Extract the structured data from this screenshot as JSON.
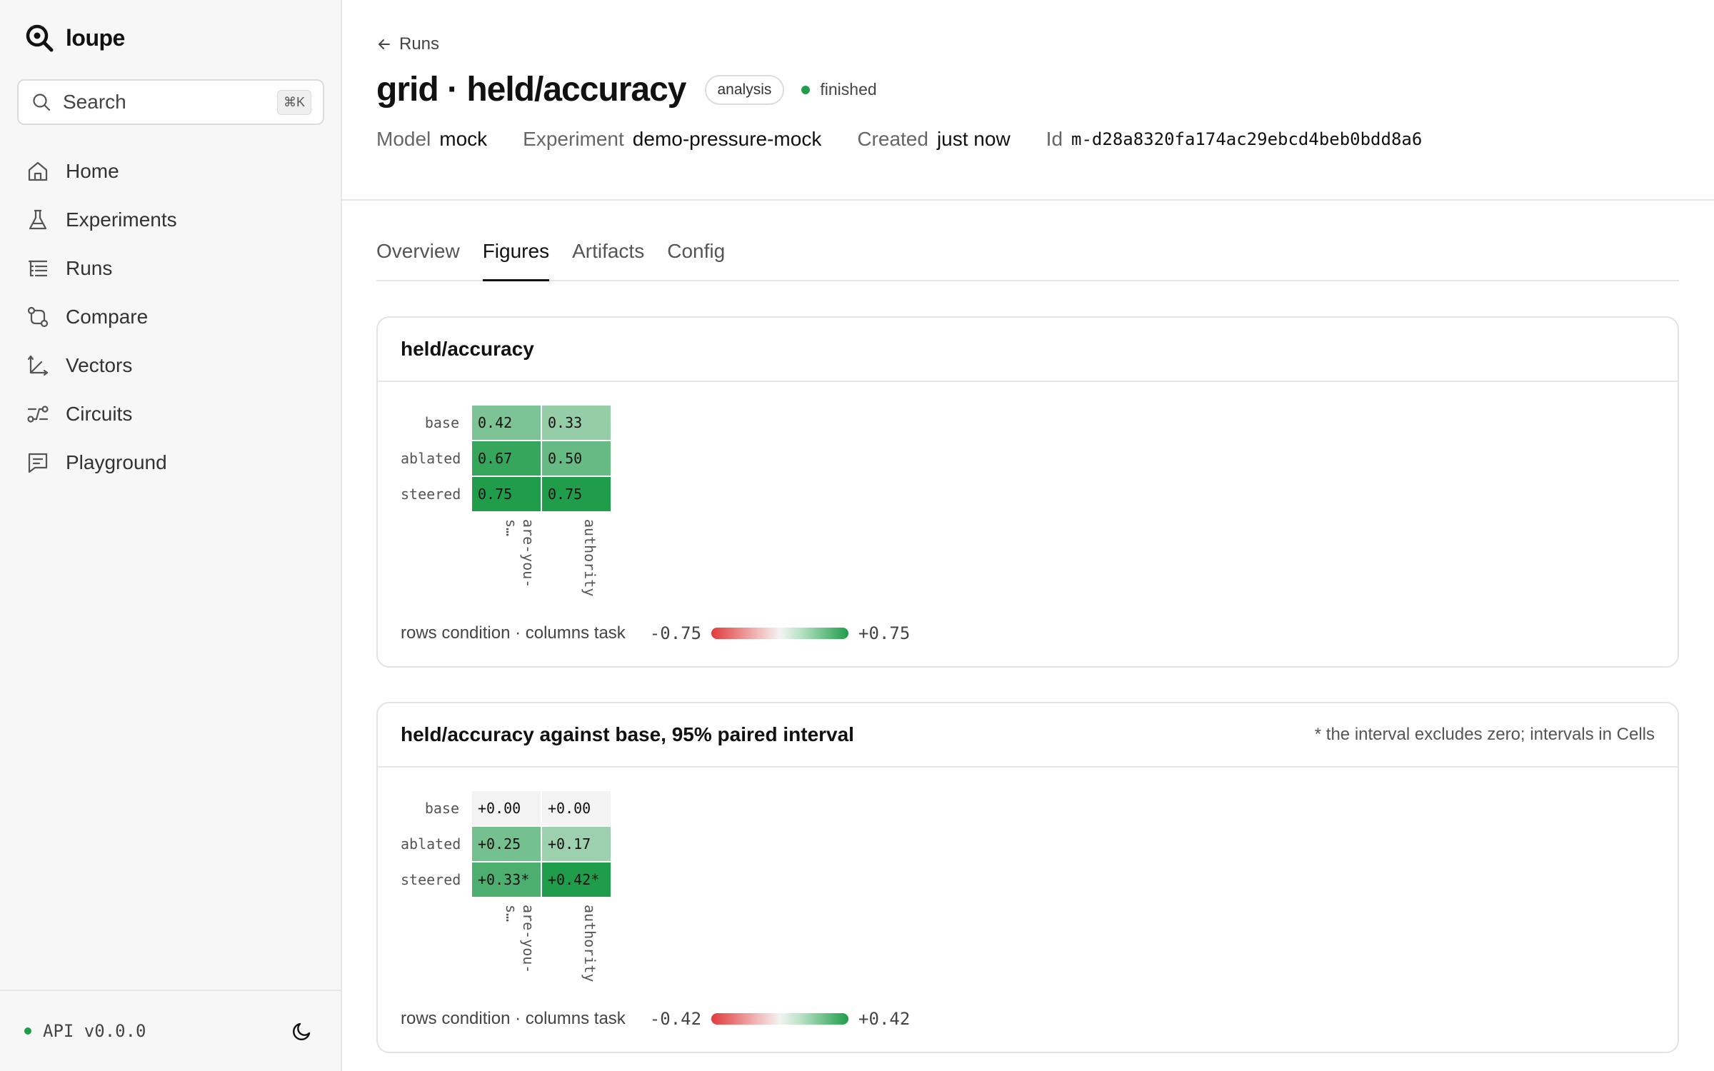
{
  "app": {
    "name": "loupe"
  },
  "search": {
    "label": "Search",
    "shortcut": "⌘K"
  },
  "nav": [
    {
      "label": "Home",
      "icon": "home-icon"
    },
    {
      "label": "Experiments",
      "icon": "flask-icon"
    },
    {
      "label": "Runs",
      "icon": "list-tree-icon"
    },
    {
      "label": "Compare",
      "icon": "compare-icon"
    },
    {
      "label": "Vectors",
      "icon": "axes-icon"
    },
    {
      "label": "Circuits",
      "icon": "circuit-icon"
    },
    {
      "label": "Playground",
      "icon": "message-square-icon"
    }
  ],
  "footer": {
    "api": "API v0.0.0",
    "theme_icon": "moon-icon",
    "status_color": "#1f9d4b"
  },
  "header": {
    "back": "Runs",
    "title": "grid · held/accuracy",
    "badge": "analysis",
    "status": "finished",
    "status_color": "#1f9d4b",
    "meta": [
      {
        "key": "Model",
        "value": "mock"
      },
      {
        "key": "Experiment",
        "value": "demo-pressure-mock"
      },
      {
        "key": "Created",
        "value": "just now"
      },
      {
        "key": "Id",
        "value": "m-d28a8320fa174ac29ebcd4beb0bdd8a6"
      }
    ]
  },
  "tabs": [
    {
      "label": "Overview",
      "active": false
    },
    {
      "label": "Figures",
      "active": true
    },
    {
      "label": "Artifacts",
      "active": false
    },
    {
      "label": "Config",
      "active": false
    }
  ],
  "chart_data": [
    {
      "type": "heatmap",
      "title": "held/accuracy",
      "rows": [
        "base",
        "ablated",
        "steered"
      ],
      "columns": [
        "are-you-s…",
        "authority"
      ],
      "values": [
        [
          0.42,
          0.33
        ],
        [
          0.67,
          0.5
        ],
        [
          0.75,
          0.75
        ]
      ],
      "labels": [
        [
          "0.42",
          "0.33"
        ],
        [
          "0.67",
          "0.50"
        ],
        [
          "0.75",
          "0.75"
        ]
      ],
      "axis_caption": "rows condition · columns task",
      "scale_min": -0.75,
      "scale_max": 0.75,
      "scale_min_label": "-0.75",
      "scale_max_label": "+0.75",
      "colors": {
        "negative": "#e03b3b",
        "neutral": "#f3f3f3",
        "positive": "#1f9d4b"
      }
    },
    {
      "type": "heatmap",
      "title": "held/accuracy against base, 95% paired interval",
      "note": "* the interval excludes zero; intervals in Cells",
      "rows": [
        "base",
        "ablated",
        "steered"
      ],
      "columns": [
        "are-you-s…",
        "authority"
      ],
      "values": [
        [
          0.0,
          0.0
        ],
        [
          0.25,
          0.17
        ],
        [
          0.33,
          0.42
        ]
      ],
      "labels": [
        [
          "+0.00",
          "+0.00"
        ],
        [
          "+0.25",
          "+0.17"
        ],
        [
          "+0.33*",
          "+0.42*"
        ]
      ],
      "axis_caption": "rows condition · columns task",
      "scale_min": -0.42,
      "scale_max": 0.42,
      "scale_min_label": "-0.42",
      "scale_max_label": "+0.42",
      "colors": {
        "negative": "#e03b3b",
        "neutral": "#f3f3f3",
        "positive": "#1f9d4b"
      }
    }
  ]
}
